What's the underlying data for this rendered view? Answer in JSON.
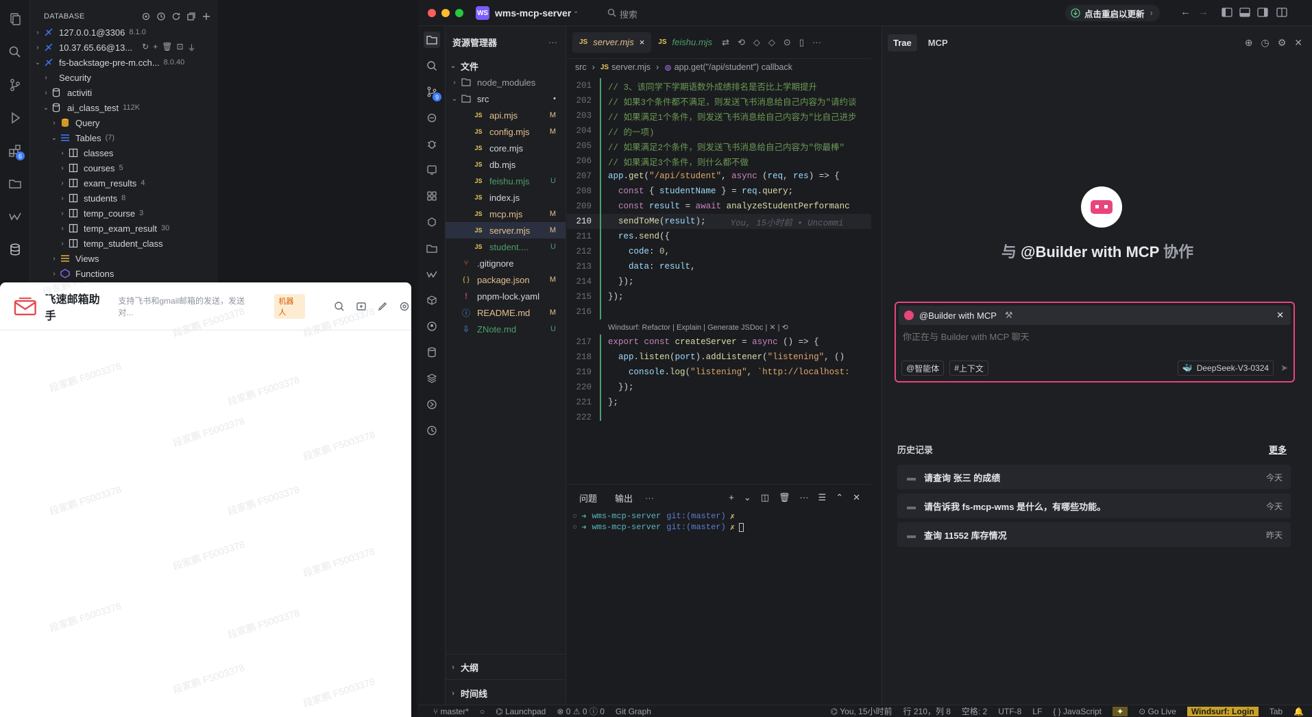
{
  "db_app": {
    "header": "DATABASE",
    "rail_badges": {
      "extensions": "6"
    },
    "tree": [
      {
        "label": "127.0.0.1@3306",
        "meta": "8.1.0",
        "level": 0,
        "chev": "›",
        "icon": "connection-icon"
      },
      {
        "label": "10.37.65.66@13...",
        "meta": "",
        "level": 0,
        "chev": "›",
        "icon": "connection-icon"
      },
      {
        "label": "fs-backstage-pre-m.cch...",
        "meta": "8.0.40",
        "level": 0,
        "chev": "⌄",
        "icon": "connection-icon"
      },
      {
        "label": "Security",
        "meta": "",
        "level": 1,
        "chev": "›",
        "icon": ""
      },
      {
        "label": "activiti",
        "meta": "",
        "level": 1,
        "chev": "›",
        "icon": "db-icon"
      },
      {
        "label": "ai_class_test",
        "meta": "112K",
        "level": 1,
        "chev": "⌄",
        "icon": "db-icon"
      },
      {
        "label": "Query",
        "meta": "",
        "level": 2,
        "chev": "›",
        "icon": "query-icon"
      },
      {
        "label": "Tables",
        "meta": "(7)",
        "level": 2,
        "chev": "⌄",
        "icon": "tables-icon"
      },
      {
        "label": "classes",
        "meta": "",
        "level": 3,
        "chev": "›",
        "icon": "table-icon"
      },
      {
        "label": "courses",
        "meta": "5",
        "level": 3,
        "chev": "›",
        "icon": "table-icon"
      },
      {
        "label": "exam_results",
        "meta": "4",
        "level": 3,
        "chev": "›",
        "icon": "table-icon"
      },
      {
        "label": "students",
        "meta": "8",
        "level": 3,
        "chev": "›",
        "icon": "table-icon"
      },
      {
        "label": "temp_course",
        "meta": "3",
        "level": 3,
        "chev": "›",
        "icon": "table-icon"
      },
      {
        "label": "temp_exam_result",
        "meta": "30",
        "level": 3,
        "chev": "›",
        "icon": "table-icon"
      },
      {
        "label": "temp_student_class",
        "meta": "",
        "level": 3,
        "chev": "›",
        "icon": "table-icon"
      },
      {
        "label": "Views",
        "meta": "",
        "level": 2,
        "chev": "›",
        "icon": "views-icon"
      },
      {
        "label": "Functions",
        "meta": "",
        "level": 2,
        "chev": "›",
        "icon": "functions-icon"
      }
    ]
  },
  "feishu": {
    "title": "飞速邮箱助手",
    "desc": "支持飞书和gmail邮箱的发送，发送对...",
    "badge": "机器人",
    "watermark": "段家鹏 F5003378"
  },
  "ide": {
    "project": "wms-mcp-server",
    "project_badge": "WS",
    "search_placeholder": "搜索",
    "update_button": "点击重启以更新",
    "activity_badges": {
      "scm": "9"
    },
    "explorer": {
      "title": "资源管理器",
      "section": "文件",
      "outline": "大纲",
      "timeline": "时间线",
      "items": [
        {
          "label": "node_modules",
          "status": "",
          "level": 0,
          "type": "folder",
          "color": "#9da1aa"
        },
        {
          "label": "src",
          "status": "•",
          "level": 0,
          "type": "folder-open",
          "color": "#d3d5da"
        },
        {
          "label": "api.mjs",
          "status": "M",
          "level": 1,
          "type": "js",
          "color": "#e2c08d"
        },
        {
          "label": "config.mjs",
          "status": "M",
          "level": 1,
          "type": "js",
          "color": "#e2c08d"
        },
        {
          "label": "core.mjs",
          "status": "",
          "level": 1,
          "type": "js",
          "color": "#d3d5da"
        },
        {
          "label": "db.mjs",
          "status": "",
          "level": 1,
          "type": "js",
          "color": "#d3d5da"
        },
        {
          "label": "feishu.mjs",
          "status": "U",
          "level": 1,
          "type": "js",
          "color": "#4c9e6a"
        },
        {
          "label": "index.js",
          "status": "",
          "level": 1,
          "type": "js",
          "color": "#d3d5da"
        },
        {
          "label": "mcp.mjs",
          "status": "M",
          "level": 1,
          "type": "js",
          "color": "#e2c08d"
        },
        {
          "label": "server.mjs",
          "status": "M",
          "level": 1,
          "type": "js",
          "color": "#e2c08d"
        },
        {
          "label": "student....",
          "status": "U",
          "level": 1,
          "type": "js",
          "color": "#4c9e6a"
        },
        {
          "label": ".gitignore",
          "status": "",
          "level": 0,
          "type": "git",
          "color": "#d3d5da"
        },
        {
          "label": "package.json",
          "status": "M",
          "level": 0,
          "type": "json",
          "color": "#e2c08d"
        },
        {
          "label": "pnpm-lock.yaml",
          "status": "",
          "level": 0,
          "type": "yaml",
          "color": "#d3d5da"
        },
        {
          "label": "README.md",
          "status": "M",
          "level": 0,
          "type": "info",
          "color": "#e2c08d"
        },
        {
          "label": "ZNote.md",
          "status": "U",
          "level": 0,
          "type": "md",
          "color": "#4c9e6a"
        }
      ]
    },
    "tabs": [
      {
        "label": "server.mjs",
        "active": true,
        "color": "#e2c08d",
        "close": "×"
      },
      {
        "label": "feishu.mjs",
        "active": false,
        "color": "#4c9e6a",
        "close": ""
      }
    ],
    "breadcrumb": {
      "p1": "src",
      "p2": "server.mjs",
      "p3": "app.get(\"/api/student\") callback"
    },
    "codelens": "Windsurf: Refactor | Explain | Generate JSDoc | ✕ | ⟲",
    "blame": "You, 15小时前 • Uncommi",
    "code": [
      {
        "n": "201",
        "t": "// 3、该同学下学期语数外成绩排名是否比上学期提升",
        "cls": "cm"
      },
      {
        "n": "202",
        "t": "// 如果3个条件都不满足，则发送飞书消息给自己内容为\"请约谈",
        "cls": "cm"
      },
      {
        "n": "203",
        "t": "// 如果满足1个条件，则发送飞书消息给自己内容为\"比自己进步",
        "cls": "cm"
      },
      {
        "n": "204",
        "t": "// 的一项)",
        "cls": "cm"
      },
      {
        "n": "205",
        "t": "// 如果满足2个条件，则发送飞书消息给自己内容为\"你最棒\"",
        "cls": "cm"
      },
      {
        "n": "206",
        "t": "// 如果满足3个条件，则什么都不做",
        "cls": "cm"
      },
      {
        "n": "207",
        "t": "app.get(\"/api/student\", async (req, res) => {",
        "cls": "code"
      },
      {
        "n": "208",
        "t": "  const { studentName } = req.query;",
        "cls": "code"
      },
      {
        "n": "209",
        "t": "  const result = await analyzeStudentPerformanc",
        "cls": "code"
      },
      {
        "n": "210",
        "t": "  sendToMe(result);",
        "cls": "code cur"
      },
      {
        "n": "211",
        "t": "  res.send({",
        "cls": "code"
      },
      {
        "n": "212",
        "t": "    code: 0,",
        "cls": "code"
      },
      {
        "n": "213",
        "t": "    data: result,",
        "cls": "code"
      },
      {
        "n": "214",
        "t": "  });",
        "cls": "code"
      },
      {
        "n": "215",
        "t": "});",
        "cls": "code"
      },
      {
        "n": "216",
        "t": "",
        "cls": "code"
      },
      {
        "n": "217",
        "t": "export const createServer = async () => {",
        "cls": "code"
      },
      {
        "n": "218",
        "t": "  app.listen(port).addListener(\"listening\", ()",
        "cls": "code"
      },
      {
        "n": "219",
        "t": "    console.log(\"listening\", `http://localhost:",
        "cls": "code"
      },
      {
        "n": "220",
        "t": "  });",
        "cls": "code"
      },
      {
        "n": "221",
        "t": "};",
        "cls": "code"
      },
      {
        "n": "222",
        "t": "",
        "cls": "code"
      }
    ],
    "panel": {
      "tab_problems": "问题",
      "tab_output": "输出",
      "terminal": [
        {
          "dir": "wms-mcp-server",
          "git": "git:(master)",
          "mark": "✗"
        },
        {
          "dir": "wms-mcp-server",
          "git": "git:(master)",
          "mark": "✗"
        }
      ]
    },
    "trae": {
      "tab_trae": "Trae",
      "tab_mcp": "MCP",
      "hero_prefix": "与 ",
      "hero_agent": "@Builder with MCP",
      "hero_suffix": " 协作",
      "chip_agent": "@Builder with MCP",
      "input_placeholder": "你正在与 Builder with MCP 聊天",
      "btn_agent": "智能体",
      "btn_context": "上下文",
      "model": "DeepSeek-V3-0324",
      "history_title": "历史记录",
      "history_more": "更多",
      "history": [
        {
          "q": "请查询 张三 的成绩",
          "d": "今天"
        },
        {
          "q": "请告诉我 fs-mcp-wms 是什么，有哪些功能。",
          "d": "今天"
        },
        {
          "q": "查询 11552 库存情况",
          "d": "昨天"
        }
      ]
    },
    "status": {
      "branch": "master*",
      "launchpad": "Launchpad",
      "problems": "0",
      "warnings": "0",
      "info": "0",
      "git_graph": "Git Graph",
      "blame": "You, 15小时前",
      "position": "行 210，列 8",
      "spaces": "空格: 2",
      "encoding": "UTF-8",
      "eol": "LF",
      "language": "JavaScript",
      "golive": "Go Live",
      "windsurf": "Windsurf: Login",
      "tab": "Tab"
    }
  },
  "colors": {
    "accent_blue": "#3e7bfa",
    "trae_pink": "#e8457a",
    "windsurf_yellow": "#c9a227",
    "modified": "#e2c08d",
    "untracked": "#4c9e6a"
  }
}
